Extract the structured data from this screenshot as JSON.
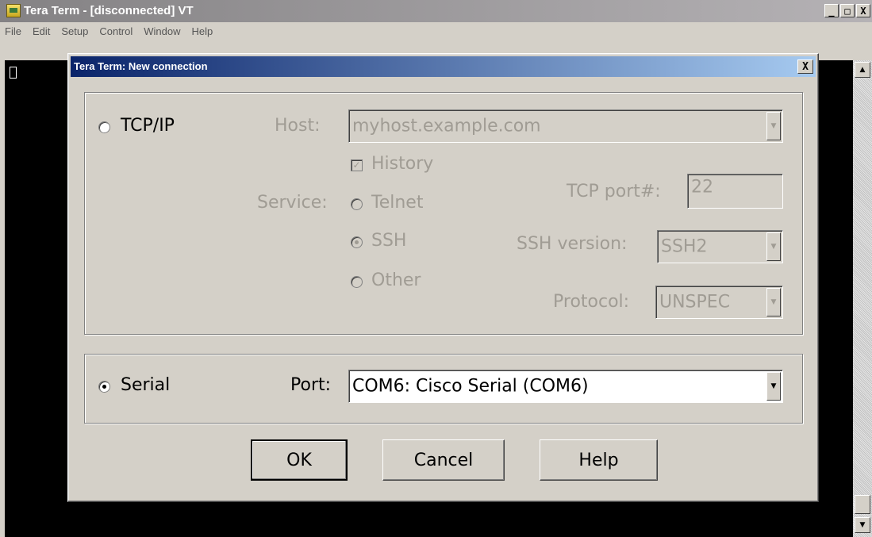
{
  "window": {
    "title": "Tera Term - [disconnected] VT",
    "controls": {
      "minimize": "_",
      "maximize": "□",
      "close": "X"
    },
    "icon": "tera-term-app-icon"
  },
  "menubar": {
    "items": [
      "File",
      "Edit",
      "Setup",
      "Control",
      "Window",
      "Help"
    ]
  },
  "dialog": {
    "title": "Tera Term: New connection",
    "close": "X",
    "tcpip": {
      "radio_label": "TCP/IP",
      "selected": false,
      "host_label": "Host:",
      "host_value": "myhost.example.com",
      "history_label": "History",
      "history_checked": true,
      "service_label": "Service:",
      "services": [
        "Telnet",
        "SSH",
        "Other"
      ],
      "selected_service": "SSH",
      "tcp_port_label": "TCP port#:",
      "tcp_port_value": "22",
      "ssh_version_label": "SSH version:",
      "ssh_version_value": "SSH2",
      "protocol_label": "Protocol:",
      "protocol_value": "UNSPEC"
    },
    "serial": {
      "radio_label": "Serial",
      "selected": true,
      "port_label": "Port:",
      "port_value": "COM6: Cisco Serial (COM6)"
    },
    "buttons": {
      "ok": "OK",
      "cancel": "Cancel",
      "help": "Help"
    }
  },
  "colors": {
    "dialog_title_start": "#0a246a",
    "dialog_title_end": "#a6caf0",
    "face": "#d4d0c8",
    "disabled_text": "#a09c94",
    "terminal_bg": "#000000"
  }
}
